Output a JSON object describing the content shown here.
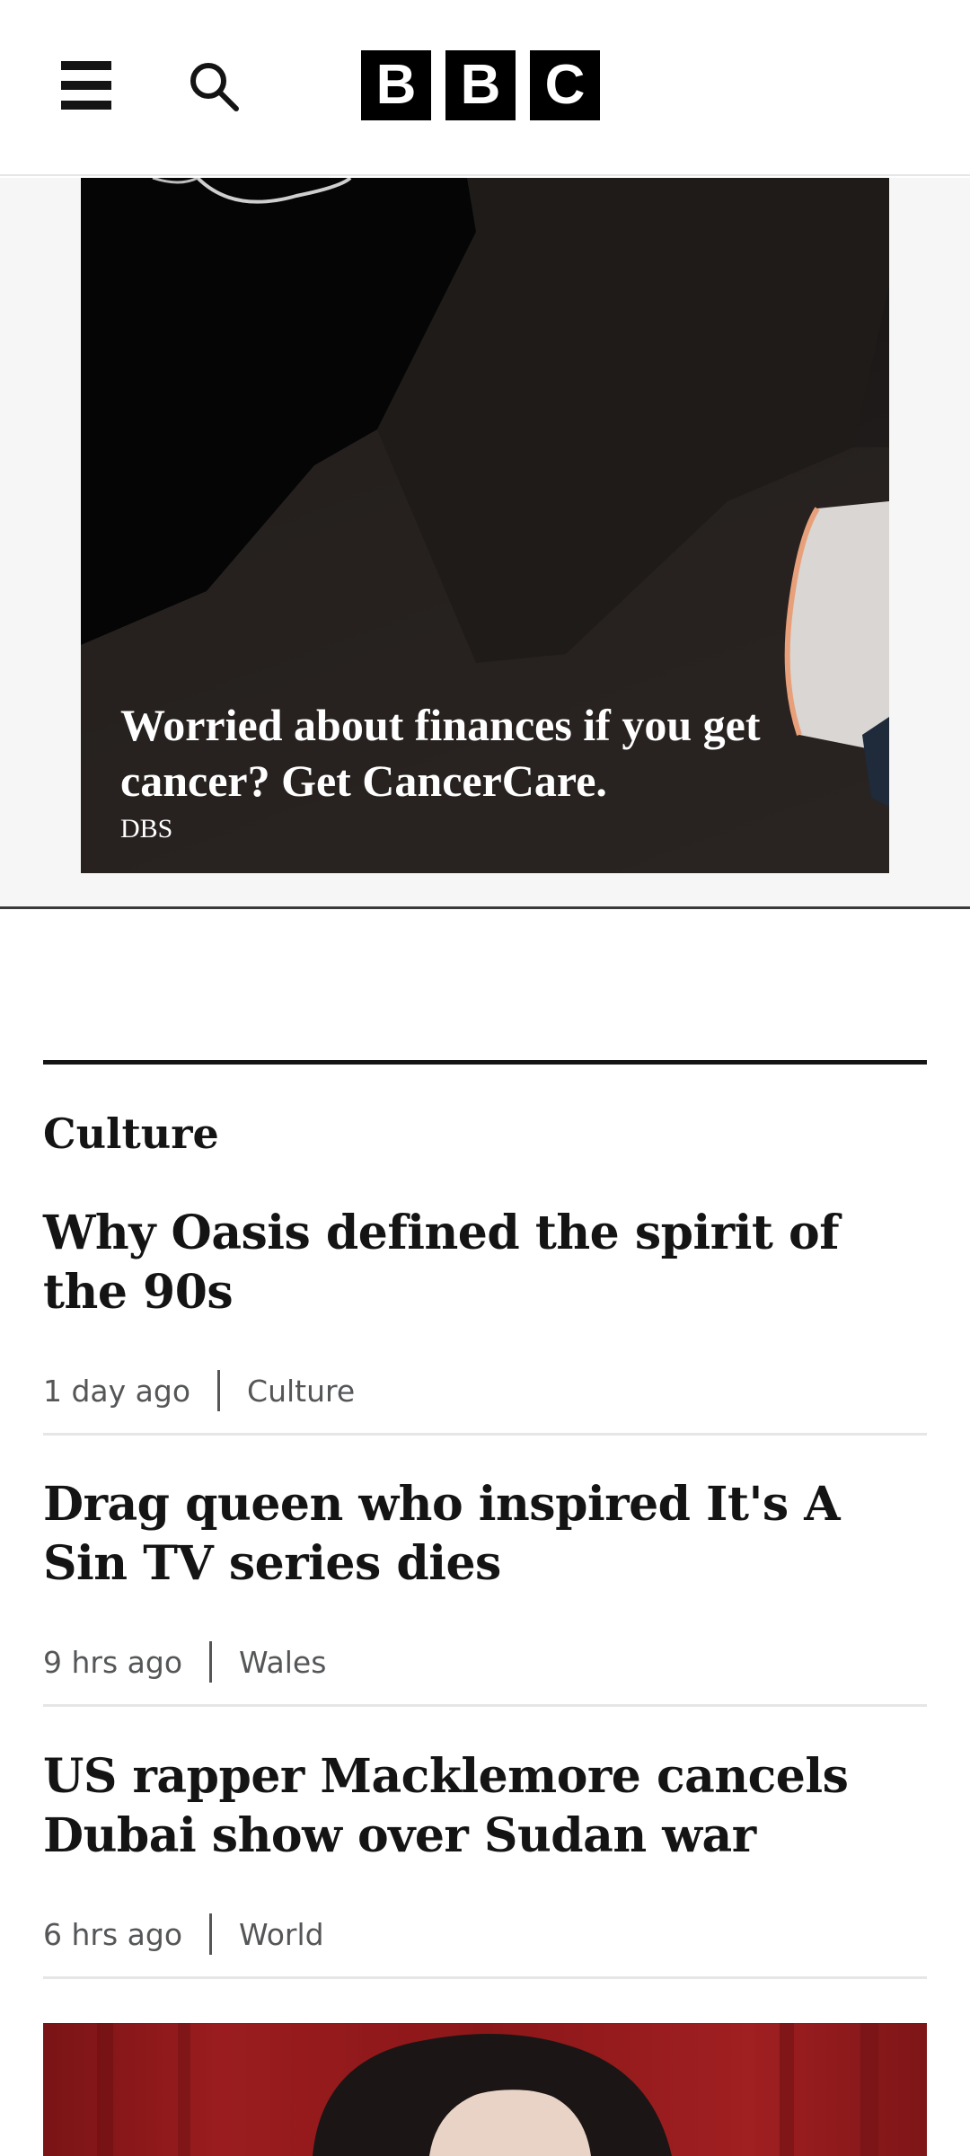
{
  "header": {
    "logo_letters": [
      "B",
      "B",
      "C"
    ]
  },
  "ad": {
    "headline": "Worried about finances if you get cancer? Get CancerCare.",
    "sponsor": "DBS"
  },
  "section": {
    "title": "Culture",
    "stories": [
      {
        "headline": "Why Oasis defined the spirit of the 90s",
        "time": "1 day ago",
        "category": "Culture"
      },
      {
        "headline": "Drag queen who inspired It's A Sin TV series dies",
        "time": "9 hrs ago",
        "category": "Wales"
      },
      {
        "headline": "US rapper Macklemore cancels Dubai show over Sudan war",
        "time": "6 hrs ago",
        "category": "World"
      }
    ]
  },
  "colors": {
    "text": "#141414",
    "meta": "#545658",
    "divider": "#e6e6e6"
  }
}
